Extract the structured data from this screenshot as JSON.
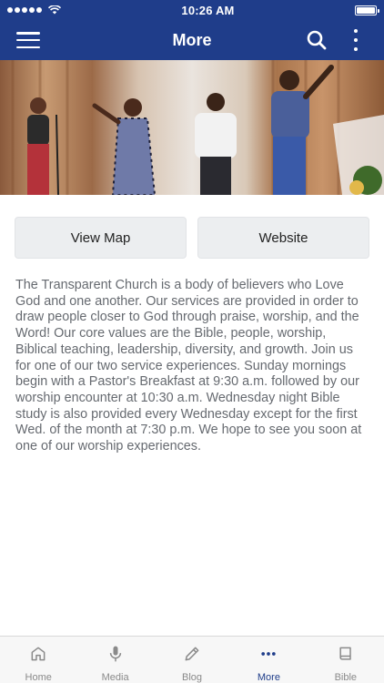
{
  "status_bar": {
    "time": "10:26 AM"
  },
  "navbar": {
    "title": "More"
  },
  "actions": {
    "map_label": "View Map",
    "website_label": "Website"
  },
  "description": "The Transparent Church is a body of believers who Love God and one another. Our services are provided in order to draw people closer to God through praise, worship, and the Word! Our core values are the Bible, people, worship, Biblical teaching, leadership, diversity, and growth. Join us for one of our two service experiences. Sunday mornings begin with a Pastor's Breakfast at 9:30 a.m. followed by our worship encounter at 10:30 a.m. Wednesday night Bible study is also provided every Wednesday except for the first Wed. of the month at 7:30 p.m. We hope to see you soon at one of our worship experiences.",
  "tabs": [
    {
      "label": "Home",
      "icon": "home-icon"
    },
    {
      "label": "Media",
      "icon": "microphone-icon"
    },
    {
      "label": "Blog",
      "icon": "pencil-icon"
    },
    {
      "label": "More",
      "icon": "dots-icon",
      "active": true
    },
    {
      "label": "Bible",
      "icon": "book-icon"
    }
  ],
  "colors": {
    "brand": "#1f3d8a",
    "tab_inactive": "#8a8a8a",
    "button_bg": "#eceef0",
    "body_text": "#666a70"
  }
}
